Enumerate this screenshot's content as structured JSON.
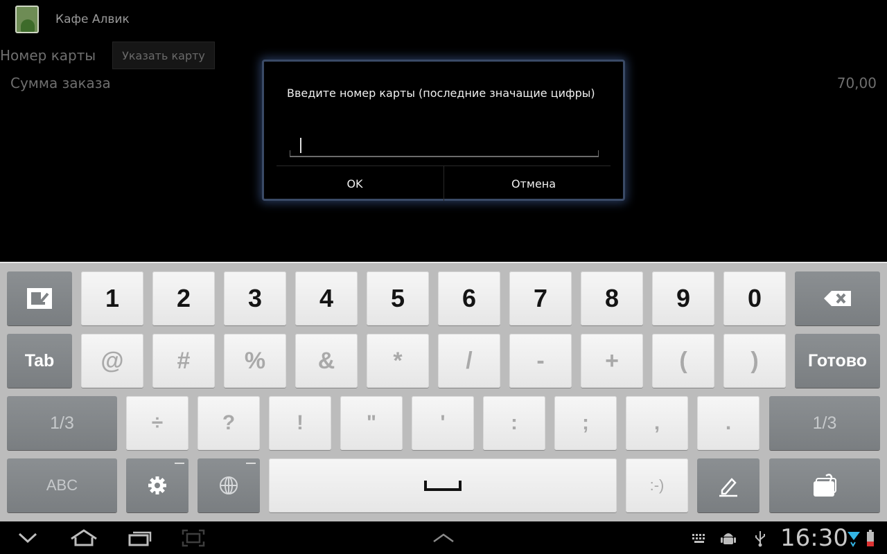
{
  "app": {
    "title": "Кафе Алвик",
    "card_label": "Номер карты",
    "card_button": "Указать карту",
    "sum_label": "Сумма заказа",
    "sum_value": "70,00"
  },
  "dialog": {
    "message": "Введите номер карты (последние значащие цифры)",
    "input_value": "",
    "ok_label": "OK",
    "cancel_label": "Отмена"
  },
  "keyboard": {
    "row1": [
      "1",
      "2",
      "3",
      "4",
      "5",
      "6",
      "7",
      "8",
      "9",
      "0"
    ],
    "row2": [
      "@",
      "#",
      "%",
      "&",
      "*",
      "/",
      "-",
      "+",
      "(",
      ")"
    ],
    "row3": [
      "÷",
      "?",
      "!",
      "\"",
      "'",
      ":",
      ";",
      ",",
      "."
    ],
    "tab_label": "Tab",
    "done_label": "Готово",
    "page_left_label": "1/3",
    "page_right_label": "1/3",
    "abc_label": "ABC",
    "smiley_label": ":-)"
  },
  "status": {
    "time": "16:30"
  },
  "icons": {
    "hide_keyboard": "hide-keyboard-icon",
    "backspace": "backspace-icon",
    "settings": "gear-icon",
    "language": "globe-icon",
    "space": "space-bar-icon",
    "handwriting": "pen-icon",
    "clipboard": "clipboard-icon",
    "nav": [
      "back-icon",
      "home-icon",
      "recent-apps-icon",
      "screenshot-icon",
      "chevron-up-icon"
    ],
    "status": [
      "keyboard-icon",
      "android-debug-icon",
      "usb-icon",
      "wifi-icon",
      "battery-icon"
    ]
  }
}
